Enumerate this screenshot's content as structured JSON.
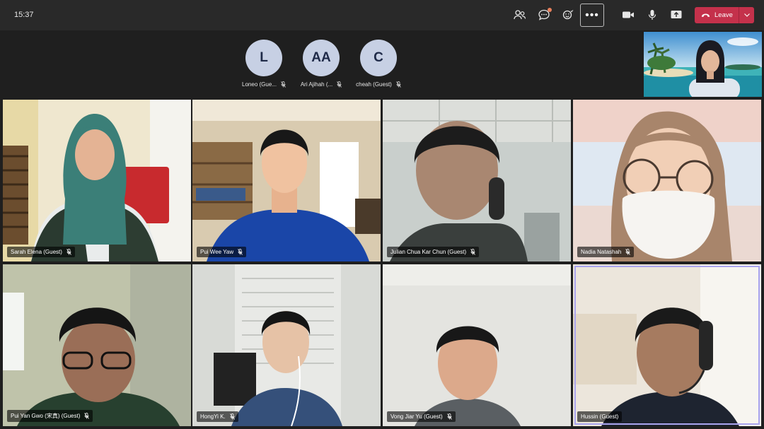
{
  "topbar": {
    "time": "15:37",
    "leave_label": "Leave"
  },
  "icons": {
    "people": "people-icon",
    "chat": "chat-icon",
    "reactions": "reactions-icon",
    "more": "more-icon",
    "camera": "camera-icon",
    "mic": "mic-icon",
    "share": "share-icon",
    "phone": "phone-icon",
    "chevron": "chevron-down-icon",
    "muted": "mic-off-icon"
  },
  "colors": {
    "leave": "#c4314b",
    "avatar_bg": "#c7d0e4",
    "avatar_text": "#1f2a48",
    "active_speaker": "#a9a4ee",
    "chat_badge": "#e8805c"
  },
  "avatars": [
    {
      "initials": "L",
      "name": "Loneo (Gue..."
    },
    {
      "initials": "AA",
      "name": "Ari Ajihah (..."
    },
    {
      "initials": "C",
      "name": "cheah (Guest)"
    }
  ],
  "tiles": [
    {
      "name": "Sarah Elena (Guest)"
    },
    {
      "name": "Pui Wee Yaw"
    },
    {
      "name": "Julian Chua Kar Chun (Guest)"
    },
    {
      "name": "Nadia Natashah"
    },
    {
      "name": "Pui Yan Gwo (宋真) (Guest)"
    },
    {
      "name": "HongYi K."
    },
    {
      "name": "Vong Jiar Yu (Guest)"
    },
    {
      "name": "Hussin (Guest)"
    }
  ]
}
